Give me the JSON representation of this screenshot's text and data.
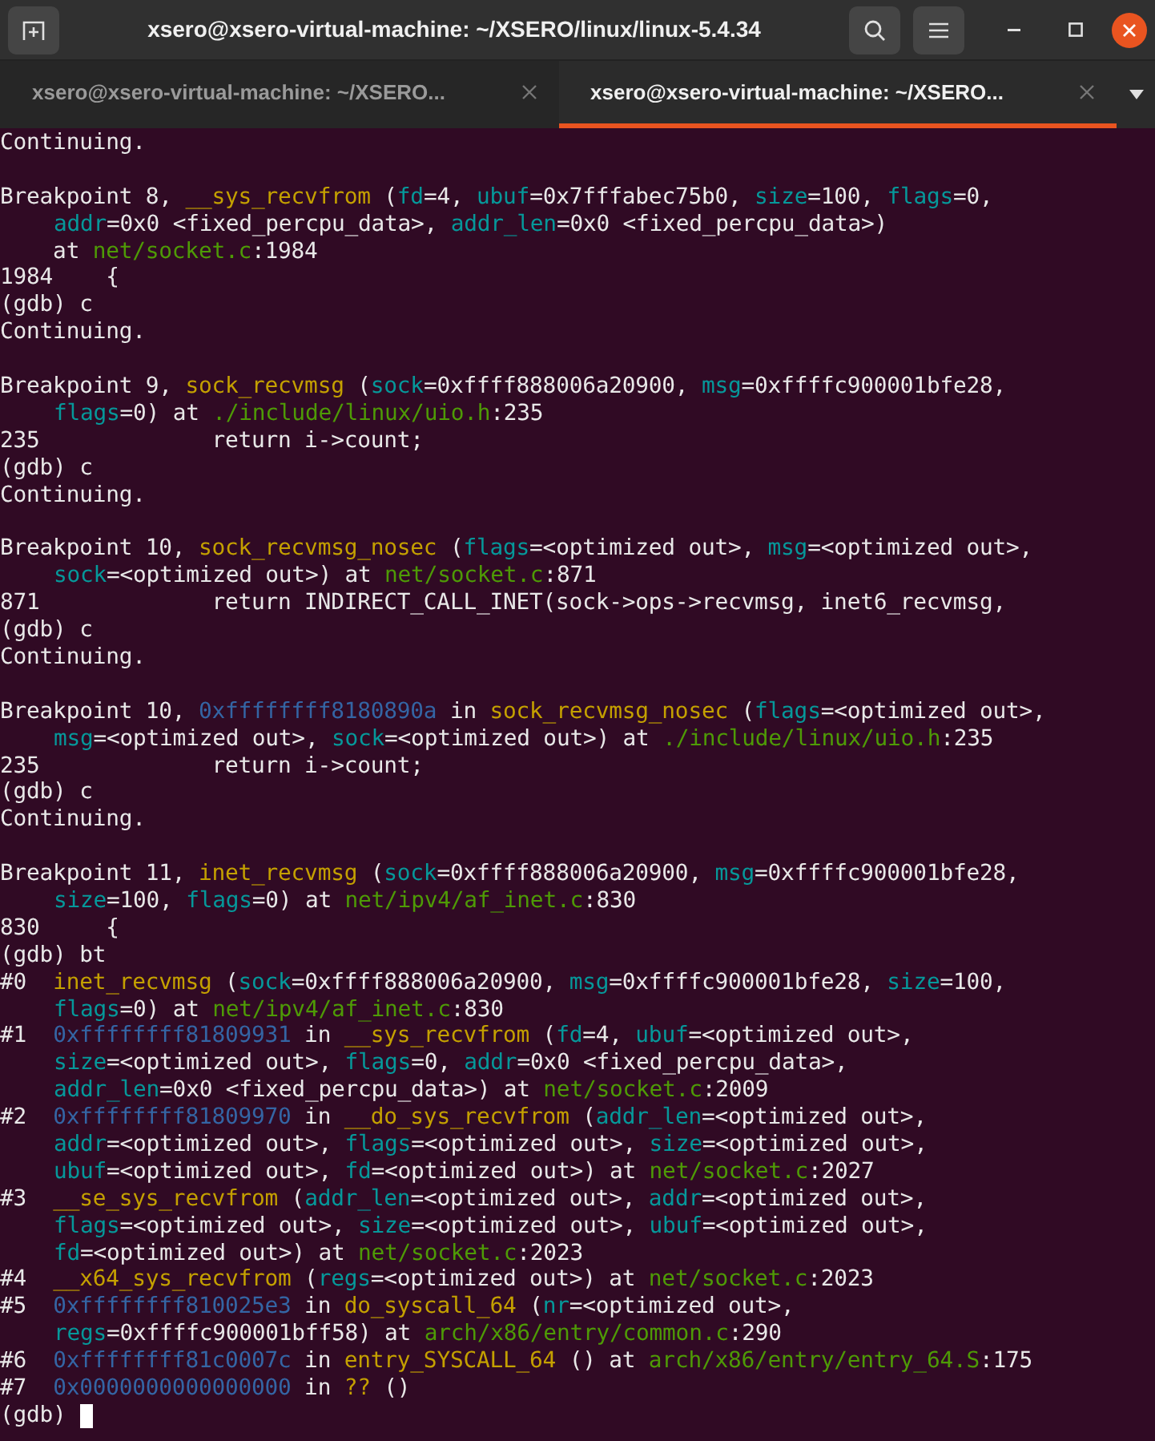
{
  "window": {
    "title": "xsero@xsero-virtual-machine: ~/XSERO/linux/linux-5.4.34"
  },
  "tabs": [
    {
      "label": "xsero@xsero-virtual-machine: ~/XSERO...",
      "selected": false
    },
    {
      "label": "xsero@xsero-virtual-machine: ~/XSERO...",
      "selected": true
    }
  ],
  "terminal": {
    "lines": [
      {
        "kind": "text",
        "spans": [
          {
            "kind": "plain",
            "text": "Continuing."
          }
        ]
      },
      {
        "kind": "blank"
      },
      {
        "kind": "text",
        "spans": [
          {
            "kind": "plain",
            "text": "Breakpoint 8, "
          },
          {
            "kind": "func",
            "text": "__sys_recvfrom"
          },
          {
            "kind": "plain",
            "text": " ("
          },
          {
            "kind": "param",
            "text": "fd"
          },
          {
            "kind": "plain",
            "text": "=4, "
          },
          {
            "kind": "param",
            "text": "ubuf"
          },
          {
            "kind": "plain",
            "text": "=0x7fffabec75b0, "
          },
          {
            "kind": "param",
            "text": "size"
          },
          {
            "kind": "plain",
            "text": "=100, "
          },
          {
            "kind": "param",
            "text": "flags"
          },
          {
            "kind": "plain",
            "text": "=0,"
          }
        ]
      },
      {
        "kind": "text",
        "indented": true,
        "spans": [
          {
            "kind": "param",
            "text": "addr"
          },
          {
            "kind": "plain",
            "text": "=0x0 <fixed_percpu_data>, "
          },
          {
            "kind": "param",
            "text": "addr_len"
          },
          {
            "kind": "plain",
            "text": "=0x0 <fixed_percpu_data>)"
          }
        ]
      },
      {
        "kind": "text",
        "spans": [
          {
            "kind": "plain",
            "text": "    at "
          },
          {
            "kind": "file",
            "text": "net/socket.c"
          },
          {
            "kind": "plain",
            "text": ":1984"
          }
        ]
      },
      {
        "kind": "text",
        "spans": [
          {
            "kind": "plain",
            "text": "1984    {"
          }
        ]
      },
      {
        "kind": "text",
        "spans": [
          {
            "kind": "plain",
            "text": "(gdb) c"
          }
        ]
      },
      {
        "kind": "text",
        "spans": [
          {
            "kind": "plain",
            "text": "Continuing."
          }
        ]
      },
      {
        "kind": "blank"
      },
      {
        "kind": "text",
        "spans": [
          {
            "kind": "plain",
            "text": "Breakpoint 9, "
          },
          {
            "kind": "func",
            "text": "sock_recvmsg"
          },
          {
            "kind": "plain",
            "text": " ("
          },
          {
            "kind": "param",
            "text": "sock"
          },
          {
            "kind": "plain",
            "text": "=0xffff888006a20900, "
          },
          {
            "kind": "param",
            "text": "msg"
          },
          {
            "kind": "plain",
            "text": "=0xffffc900001bfe28,"
          }
        ]
      },
      {
        "kind": "text",
        "indented": true,
        "spans": [
          {
            "kind": "param",
            "text": "flags"
          },
          {
            "kind": "plain",
            "text": "=0) at "
          },
          {
            "kind": "file",
            "text": "./include/linux/uio.h"
          },
          {
            "kind": "plain",
            "text": ":235"
          }
        ]
      },
      {
        "kind": "text",
        "spans": [
          {
            "kind": "plain",
            "text": "235             return i->count;"
          }
        ]
      },
      {
        "kind": "text",
        "spans": [
          {
            "kind": "plain",
            "text": "(gdb) c"
          }
        ]
      },
      {
        "kind": "text",
        "spans": [
          {
            "kind": "plain",
            "text": "Continuing."
          }
        ]
      },
      {
        "kind": "blank"
      },
      {
        "kind": "text",
        "spans": [
          {
            "kind": "plain",
            "text": "Breakpoint 10, "
          },
          {
            "kind": "func",
            "text": "sock_recvmsg_nosec"
          },
          {
            "kind": "plain",
            "text": " ("
          },
          {
            "kind": "param",
            "text": "flags"
          },
          {
            "kind": "plain",
            "text": "=<optimized out>, "
          },
          {
            "kind": "param",
            "text": "msg"
          },
          {
            "kind": "plain",
            "text": "=<optimized out>,"
          }
        ]
      },
      {
        "kind": "text",
        "indented": true,
        "spans": [
          {
            "kind": "param",
            "text": "sock"
          },
          {
            "kind": "plain",
            "text": "=<optimized out>) at "
          },
          {
            "kind": "file",
            "text": "net/socket.c"
          },
          {
            "kind": "plain",
            "text": ":871"
          }
        ]
      },
      {
        "kind": "text",
        "spans": [
          {
            "kind": "plain",
            "text": "871             return INDIRECT_CALL_INET(sock->ops->recvmsg, inet6_recvmsg,"
          }
        ]
      },
      {
        "kind": "text",
        "spans": [
          {
            "kind": "plain",
            "text": "(gdb) c"
          }
        ]
      },
      {
        "kind": "text",
        "spans": [
          {
            "kind": "plain",
            "text": "Continuing."
          }
        ]
      },
      {
        "kind": "blank"
      },
      {
        "kind": "text",
        "spans": [
          {
            "kind": "plain",
            "text": "Breakpoint 10, "
          },
          {
            "kind": "addr",
            "text": "0xffffffff8180890a"
          },
          {
            "kind": "plain",
            "text": " in "
          },
          {
            "kind": "func",
            "text": "sock_recvmsg_nosec"
          },
          {
            "kind": "plain",
            "text": " ("
          },
          {
            "kind": "param",
            "text": "flags"
          },
          {
            "kind": "plain",
            "text": "=<optimized out>,"
          }
        ]
      },
      {
        "kind": "text",
        "indented": true,
        "spans": [
          {
            "kind": "param",
            "text": "msg"
          },
          {
            "kind": "plain",
            "text": "=<optimized out>, "
          },
          {
            "kind": "param",
            "text": "sock"
          },
          {
            "kind": "plain",
            "text": "=<optimized out>) at "
          },
          {
            "kind": "file",
            "text": "./include/linux/uio.h"
          },
          {
            "kind": "plain",
            "text": ":235"
          }
        ]
      },
      {
        "kind": "text",
        "spans": [
          {
            "kind": "plain",
            "text": "235             return i->count;"
          }
        ]
      },
      {
        "kind": "text",
        "spans": [
          {
            "kind": "plain",
            "text": "(gdb) c"
          }
        ]
      },
      {
        "kind": "text",
        "spans": [
          {
            "kind": "plain",
            "text": "Continuing."
          }
        ]
      },
      {
        "kind": "blank"
      },
      {
        "kind": "text",
        "spans": [
          {
            "kind": "plain",
            "text": "Breakpoint 11, "
          },
          {
            "kind": "func",
            "text": "inet_recvmsg"
          },
          {
            "kind": "plain",
            "text": " ("
          },
          {
            "kind": "param",
            "text": "sock"
          },
          {
            "kind": "plain",
            "text": "=0xffff888006a20900, "
          },
          {
            "kind": "param",
            "text": "msg"
          },
          {
            "kind": "plain",
            "text": "=0xffffc900001bfe28,"
          }
        ]
      },
      {
        "kind": "text",
        "indented": true,
        "spans": [
          {
            "kind": "param",
            "text": "size"
          },
          {
            "kind": "plain",
            "text": "=100, "
          },
          {
            "kind": "param",
            "text": "flags"
          },
          {
            "kind": "plain",
            "text": "=0) at "
          },
          {
            "kind": "file",
            "text": "net/ipv4/af_inet.c"
          },
          {
            "kind": "plain",
            "text": ":830"
          }
        ]
      },
      {
        "kind": "text",
        "spans": [
          {
            "kind": "plain",
            "text": "830     {"
          }
        ]
      },
      {
        "kind": "text",
        "spans": [
          {
            "kind": "plain",
            "text": "(gdb) bt"
          }
        ]
      },
      {
        "kind": "text",
        "spans": [
          {
            "kind": "plain",
            "text": "#0  "
          },
          {
            "kind": "func",
            "text": "inet_recvmsg"
          },
          {
            "kind": "plain",
            "text": " ("
          },
          {
            "kind": "param",
            "text": "sock"
          },
          {
            "kind": "plain",
            "text": "=0xffff888006a20900, "
          },
          {
            "kind": "param",
            "text": "msg"
          },
          {
            "kind": "plain",
            "text": "=0xffffc900001bfe28, "
          },
          {
            "kind": "param",
            "text": "size"
          },
          {
            "kind": "plain",
            "text": "=100,"
          }
        ]
      },
      {
        "kind": "text",
        "indented": true,
        "spans": [
          {
            "kind": "param",
            "text": "flags"
          },
          {
            "kind": "plain",
            "text": "=0) at "
          },
          {
            "kind": "file",
            "text": "net/ipv4/af_inet.c"
          },
          {
            "kind": "plain",
            "text": ":830"
          }
        ]
      },
      {
        "kind": "text",
        "spans": [
          {
            "kind": "plain",
            "text": "#1  "
          },
          {
            "kind": "addr",
            "text": "0xffffffff81809931"
          },
          {
            "kind": "plain",
            "text": " in "
          },
          {
            "kind": "func",
            "text": "__sys_recvfrom"
          },
          {
            "kind": "plain",
            "text": " ("
          },
          {
            "kind": "param",
            "text": "fd"
          },
          {
            "kind": "plain",
            "text": "=4, "
          },
          {
            "kind": "param",
            "text": "ubuf"
          },
          {
            "kind": "plain",
            "text": "=<optimized out>,"
          }
        ]
      },
      {
        "kind": "text",
        "indented": true,
        "spans": [
          {
            "kind": "param",
            "text": "size"
          },
          {
            "kind": "plain",
            "text": "=<optimized out>, "
          },
          {
            "kind": "param",
            "text": "flags"
          },
          {
            "kind": "plain",
            "text": "=0, "
          },
          {
            "kind": "param",
            "text": "addr"
          },
          {
            "kind": "plain",
            "text": "=0x0 <fixed_percpu_data>,"
          }
        ]
      },
      {
        "kind": "text",
        "indented": true,
        "spans": [
          {
            "kind": "param",
            "text": "addr_len"
          },
          {
            "kind": "plain",
            "text": "=0x0 <fixed_percpu_data>) at "
          },
          {
            "kind": "file",
            "text": "net/socket.c"
          },
          {
            "kind": "plain",
            "text": ":2009"
          }
        ]
      },
      {
        "kind": "text",
        "spans": [
          {
            "kind": "plain",
            "text": "#2  "
          },
          {
            "kind": "addr",
            "text": "0xffffffff81809970"
          },
          {
            "kind": "plain",
            "text": " in "
          },
          {
            "kind": "func",
            "text": "__do_sys_recvfrom"
          },
          {
            "kind": "plain",
            "text": " ("
          },
          {
            "kind": "param",
            "text": "addr_len"
          },
          {
            "kind": "plain",
            "text": "=<optimized out>,"
          }
        ]
      },
      {
        "kind": "text",
        "indented": true,
        "spans": [
          {
            "kind": "param",
            "text": "addr"
          },
          {
            "kind": "plain",
            "text": "=<optimized out>, "
          },
          {
            "kind": "param",
            "text": "flags"
          },
          {
            "kind": "plain",
            "text": "=<optimized out>, "
          },
          {
            "kind": "param",
            "text": "size"
          },
          {
            "kind": "plain",
            "text": "=<optimized out>,"
          }
        ]
      },
      {
        "kind": "text",
        "indented": true,
        "spans": [
          {
            "kind": "param",
            "text": "ubuf"
          },
          {
            "kind": "plain",
            "text": "=<optimized out>, "
          },
          {
            "kind": "param",
            "text": "fd"
          },
          {
            "kind": "plain",
            "text": "=<optimized out>) at "
          },
          {
            "kind": "file",
            "text": "net/socket.c"
          },
          {
            "kind": "plain",
            "text": ":2027"
          }
        ]
      },
      {
        "kind": "text",
        "spans": [
          {
            "kind": "plain",
            "text": "#3  "
          },
          {
            "kind": "func",
            "text": "__se_sys_recvfrom"
          },
          {
            "kind": "plain",
            "text": " ("
          },
          {
            "kind": "param",
            "text": "addr_len"
          },
          {
            "kind": "plain",
            "text": "=<optimized out>, "
          },
          {
            "kind": "param",
            "text": "addr"
          },
          {
            "kind": "plain",
            "text": "=<optimized out>,"
          }
        ]
      },
      {
        "kind": "text",
        "indented": true,
        "spans": [
          {
            "kind": "param",
            "text": "flags"
          },
          {
            "kind": "plain",
            "text": "=<optimized out>, "
          },
          {
            "kind": "param",
            "text": "size"
          },
          {
            "kind": "plain",
            "text": "=<optimized out>, "
          },
          {
            "kind": "param",
            "text": "ubuf"
          },
          {
            "kind": "plain",
            "text": "=<optimized out>,"
          }
        ]
      },
      {
        "kind": "text",
        "indented": true,
        "spans": [
          {
            "kind": "param",
            "text": "fd"
          },
          {
            "kind": "plain",
            "text": "=<optimized out>) at "
          },
          {
            "kind": "file",
            "text": "net/socket.c"
          },
          {
            "kind": "plain",
            "text": ":2023"
          }
        ]
      },
      {
        "kind": "text",
        "spans": [
          {
            "kind": "plain",
            "text": "#4  "
          },
          {
            "kind": "func",
            "text": "__x64_sys_recvfrom"
          },
          {
            "kind": "plain",
            "text": " ("
          },
          {
            "kind": "param",
            "text": "regs"
          },
          {
            "kind": "plain",
            "text": "=<optimized out>) at "
          },
          {
            "kind": "file",
            "text": "net/socket.c"
          },
          {
            "kind": "plain",
            "text": ":2023"
          }
        ]
      },
      {
        "kind": "text",
        "spans": [
          {
            "kind": "plain",
            "text": "#5  "
          },
          {
            "kind": "addr",
            "text": "0xffffffff810025e3"
          },
          {
            "kind": "plain",
            "text": " in "
          },
          {
            "kind": "func",
            "text": "do_syscall_64"
          },
          {
            "kind": "plain",
            "text": " ("
          },
          {
            "kind": "param",
            "text": "nr"
          },
          {
            "kind": "plain",
            "text": "=<optimized out>,"
          }
        ]
      },
      {
        "kind": "text",
        "indented": true,
        "spans": [
          {
            "kind": "param",
            "text": "regs"
          },
          {
            "kind": "plain",
            "text": "=0xffffc900001bff58) at "
          },
          {
            "kind": "file",
            "text": "arch/x86/entry/common.c"
          },
          {
            "kind": "plain",
            "text": ":290"
          }
        ]
      },
      {
        "kind": "text",
        "spans": [
          {
            "kind": "plain",
            "text": "#6  "
          },
          {
            "kind": "addr",
            "text": "0xffffffff81c0007c"
          },
          {
            "kind": "plain",
            "text": " in "
          },
          {
            "kind": "func",
            "text": "entry_SYSCALL_64"
          },
          {
            "kind": "plain",
            "text": " () at "
          },
          {
            "kind": "file",
            "text": "arch/x86/entry/entry_64.S"
          },
          {
            "kind": "plain",
            "text": ":175"
          }
        ]
      },
      {
        "kind": "text",
        "spans": [
          {
            "kind": "plain",
            "text": "#7  "
          },
          {
            "kind": "addr",
            "text": "0x0000000000000000"
          },
          {
            "kind": "plain",
            "text": " in "
          },
          {
            "kind": "func",
            "text": "??"
          },
          {
            "kind": "plain",
            "text": " ()"
          }
        ]
      },
      {
        "kind": "prompt",
        "spans": [
          {
            "kind": "plain",
            "text": "(gdb)"
          }
        ],
        "cursor": true
      }
    ]
  }
}
